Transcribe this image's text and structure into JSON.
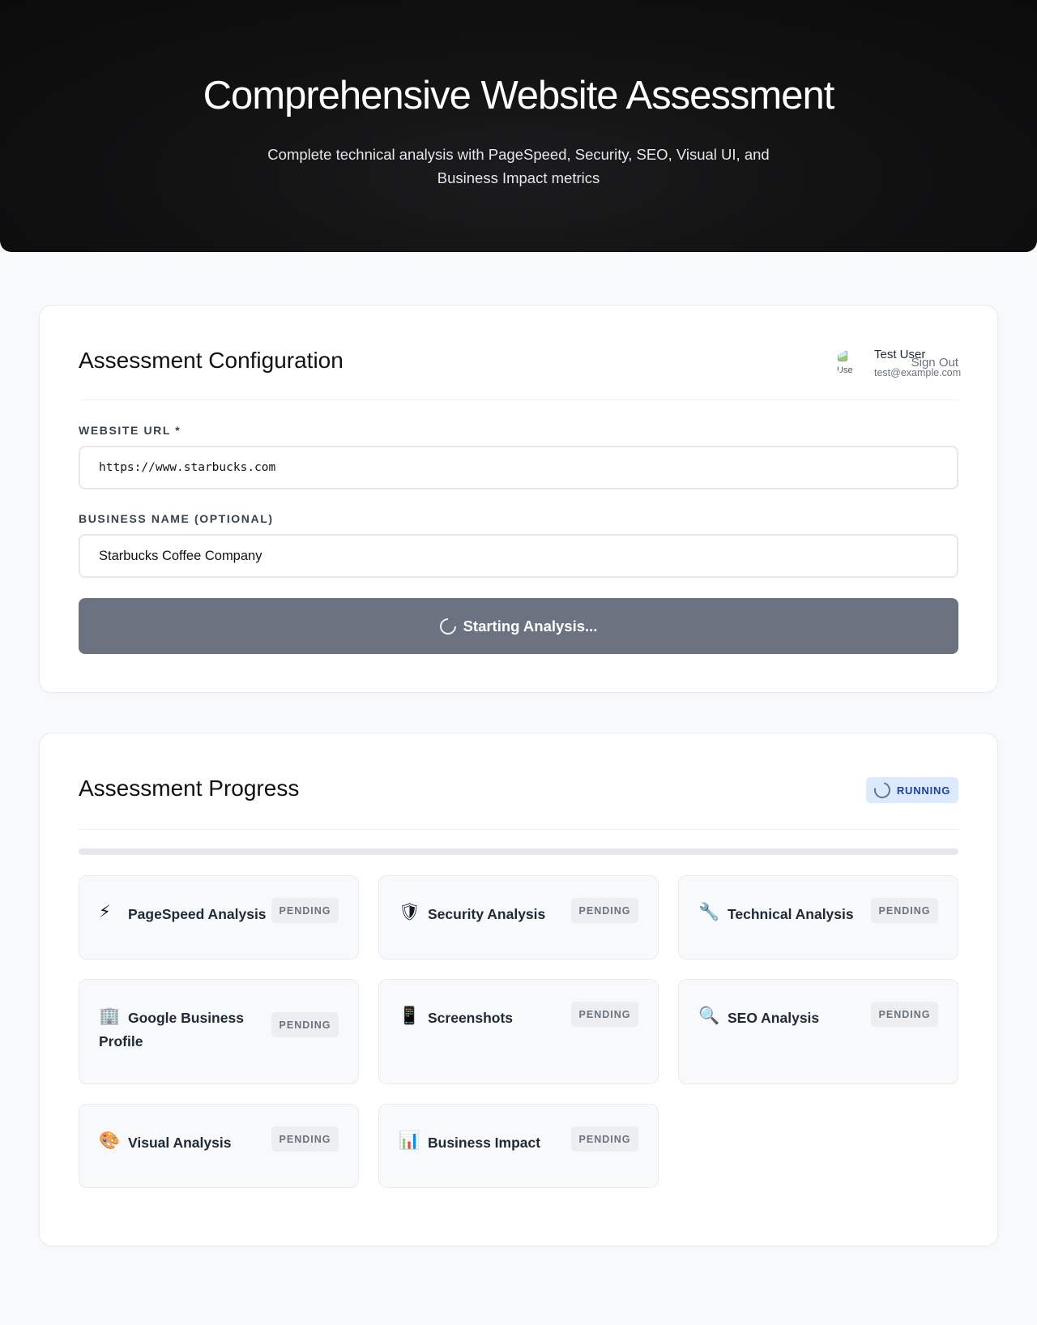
{
  "hero": {
    "title": "Comprehensive Website Assessment",
    "subtitle": "Complete technical analysis with PageSpeed, Security, SEO, Visual UI, and Business Impact metrics"
  },
  "config": {
    "title": "Assessment Configuration",
    "user": {
      "avatar_alt": "Use",
      "name": "Test User",
      "email": "test@example.com",
      "sign_out": "Sign Out"
    },
    "url_field": {
      "label": "WEBSITE URL *",
      "value": "https://www.starbucks.com"
    },
    "business_field": {
      "label": "BUSINESS NAME (OPTIONAL)",
      "value": "Starbucks Coffee Company"
    },
    "submit_label": "Starting Analysis..."
  },
  "progress": {
    "title": "Assessment Progress",
    "status": "RUNNING",
    "percent": 0,
    "steps": [
      {
        "icon": "lightning-icon",
        "glyph": "⚡",
        "name": "PageSpeed Analysis",
        "status": "PENDING"
      },
      {
        "icon": "shield-icon",
        "glyph": "🛡",
        "name": "Security Analysis",
        "status": "PENDING"
      },
      {
        "icon": "wrench-icon",
        "glyph": "🔧",
        "name": "Technical Analysis",
        "status": "PENDING"
      },
      {
        "icon": "building-icon",
        "glyph": "🏢",
        "name": "Google Business Profile",
        "status": "PENDING"
      },
      {
        "icon": "phone-icon",
        "glyph": "📱",
        "name": "Screenshots",
        "status": "PENDING"
      },
      {
        "icon": "magnifier-icon",
        "glyph": "🔍",
        "name": "SEO Analysis",
        "status": "PENDING"
      },
      {
        "icon": "palette-icon",
        "glyph": "🎨",
        "name": "Visual Analysis",
        "status": "PENDING"
      },
      {
        "icon": "chart-icon",
        "glyph": "📊",
        "name": "Business Impact",
        "status": "PENDING"
      }
    ]
  },
  "colors": {
    "accent": "#3b82f6",
    "button_disabled": "#6b7280",
    "badge_bg": "#dbeafe",
    "badge_text": "#1e40af"
  }
}
